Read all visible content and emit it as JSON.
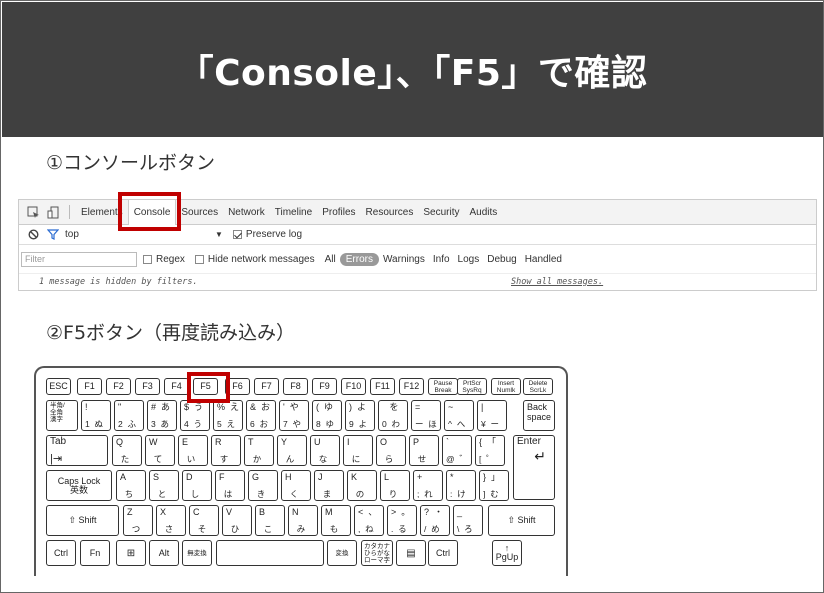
{
  "slide": {
    "title": "「Console」、「F5」で確認",
    "label1": "①コンソールボタン",
    "label2": "②F5ボタン（再度読み込み）"
  },
  "devtools": {
    "tabs": [
      "Elements",
      "Console",
      "Sources",
      "Network",
      "Timeline",
      "Profiles",
      "Resources",
      "Security",
      "Audits"
    ],
    "active_tab": "Console",
    "context": "top",
    "preserve_log": "Preserve log",
    "filter_placeholder": "Filter",
    "regex": "Regex",
    "hide_network": "Hide network messages",
    "levels": [
      "All",
      "Errors",
      "Warnings",
      "Info",
      "Logs",
      "Debug",
      "Handled"
    ],
    "active_level": "Errors",
    "message": "1 message is hidden by filters.",
    "show_all": "Show all messages."
  },
  "keyboard": {
    "row1": [
      "ESC",
      "F1",
      "F2",
      "F3",
      "F4",
      "F5",
      "F6",
      "F7",
      "F8",
      "F9",
      "F10",
      "F11",
      "F12",
      "Pause\nBreak",
      "PrtScr\nSysRq",
      "Insert\nNumlk",
      "Delete\nScrLk"
    ],
    "row2": [
      {
        "t": "半角/\n全角\n漢字",
        "b": ""
      },
      {
        "t": "!",
        "b": "1  ぬ"
      },
      {
        "t": "\"",
        "b": "2  ふ"
      },
      {
        "t": "#  あ",
        "b": "3  あ"
      },
      {
        "t": "$  う",
        "b": "4  う"
      },
      {
        "t": "%  え",
        "b": "5  え"
      },
      {
        "t": "&  お",
        "b": "6  お"
      },
      {
        "t": "'  や",
        "b": "7  や"
      },
      {
        "t": "(  ゆ",
        "b": "8  ゆ"
      },
      {
        "t": ")  よ",
        "b": "9  よ"
      },
      {
        "t": "   を",
        "b": "0  わ"
      },
      {
        "t": "=",
        "b": "ー  ほ"
      },
      {
        "t": "~",
        "b": "^  へ"
      },
      {
        "t": "|",
        "b": "¥  ー"
      },
      {
        "t": "Back\nspace",
        "b": ""
      }
    ],
    "row3": [
      {
        "t": "Tab",
        "b": ""
      },
      {
        "t": "Q",
        "b": "  た"
      },
      {
        "t": "W",
        "b": "  て"
      },
      {
        "t": "E",
        "b": "  い"
      },
      {
        "t": "R",
        "b": "  す"
      },
      {
        "t": "T",
        "b": "  か"
      },
      {
        "t": "Y",
        "b": "  ん"
      },
      {
        "t": "U",
        "b": "  な"
      },
      {
        "t": "I",
        "b": "  に"
      },
      {
        "t": "O",
        "b": "  ら"
      },
      {
        "t": "P",
        "b": "  せ"
      },
      {
        "t": "`",
        "b": "@  ゛"
      },
      {
        "t": "{  「",
        "b": "[  ゜"
      },
      {
        "t": "Enter",
        "b": ""
      }
    ],
    "row4": [
      {
        "t": "Caps Lock\n英数",
        "b": ""
      },
      {
        "t": "A",
        "b": "  ち"
      },
      {
        "t": "S",
        "b": "  と"
      },
      {
        "t": "D",
        "b": "  し"
      },
      {
        "t": "F",
        "b": "  は"
      },
      {
        "t": "G",
        "b": "  き"
      },
      {
        "t": "H",
        "b": "  く"
      },
      {
        "t": "J",
        "b": "  ま"
      },
      {
        "t": "K",
        "b": "  の"
      },
      {
        "t": "L",
        "b": "  り"
      },
      {
        "t": "+",
        "b": ";  れ"
      },
      {
        "t": "*",
        "b": ":  け"
      },
      {
        "t": "}  」",
        "b": "]  む"
      }
    ],
    "row5": [
      {
        "t": "⇧ Shift",
        "b": ""
      },
      {
        "t": "Z",
        "b": "  つ"
      },
      {
        "t": "X",
        "b": "  さ"
      },
      {
        "t": "C",
        "b": "  そ"
      },
      {
        "t": "V",
        "b": "  ひ"
      },
      {
        "t": "B",
        "b": "  こ"
      },
      {
        "t": "N",
        "b": "  み"
      },
      {
        "t": "M",
        "b": "  も"
      },
      {
        "t": "<  、",
        "b": ",  ね"
      },
      {
        "t": ">  。",
        "b": ".  る"
      },
      {
        "t": "?  ・",
        "b": "/  め"
      },
      {
        "t": "_",
        "b": "\\  ろ"
      },
      {
        "t": "⇧ Shift",
        "b": ""
      }
    ],
    "row6": [
      "Ctrl",
      "Fn",
      "⊞",
      "Alt",
      "無変換",
      "",
      "変換",
      "カタカナ\nひらがな\nローマ字",
      "▤",
      "Ctrl",
      "↑\nPgUp"
    ]
  }
}
